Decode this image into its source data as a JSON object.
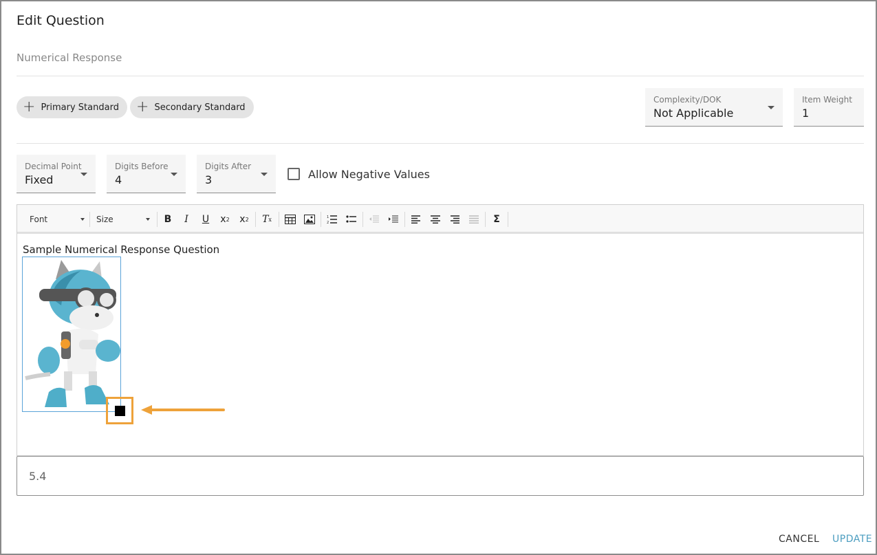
{
  "dialog": {
    "title": "Edit Question",
    "subtitle": "Numerical Response"
  },
  "standards": {
    "primary_label": "Primary Standard",
    "secondary_label": "Secondary Standard"
  },
  "complexity": {
    "label": "Complexity/DOK",
    "value": "Not Applicable"
  },
  "item_weight": {
    "label": "Item Weight",
    "value": "1"
  },
  "decimal_point": {
    "label": "Decimal Point",
    "value": "Fixed"
  },
  "digits_before": {
    "label": "Digits Before",
    "value": "4"
  },
  "digits_after": {
    "label": "Digits After",
    "value": "3"
  },
  "allow_negative": {
    "label": "Allow Negative Values",
    "checked": false
  },
  "toolbar": {
    "font_label": "Font",
    "size_label": "Size",
    "buttons": [
      "bold",
      "italic",
      "underline",
      "subscript",
      "superscript",
      "remove-format",
      "table",
      "image",
      "numbered-list",
      "bulleted-list",
      "decrease-indent",
      "increase-indent",
      "align-left",
      "align-center",
      "align-right",
      "justify",
      "math"
    ]
  },
  "editor": {
    "text": "Sample Numerical Response Question"
  },
  "answer": {
    "value": "5.4"
  },
  "actions": {
    "cancel": "CANCEL",
    "update": "UPDATE"
  },
  "colors": {
    "accent": "#4b9dc0",
    "highlight": "#eea23a",
    "image_border": "#5aa3d8"
  }
}
